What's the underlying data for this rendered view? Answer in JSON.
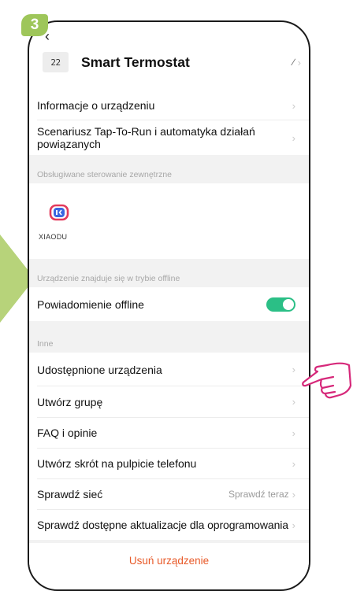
{
  "step": {
    "number": "3"
  },
  "colors": {
    "accent": "#9ec65a",
    "toggle_on": "#2bbf86",
    "danger": "#e85a29",
    "hand": "#d6287a"
  },
  "header": {
    "back_icon": "chevron-left-icon",
    "device_icon_text": "22",
    "title": "Smart Termostat",
    "edit_icon": "pencil-icon"
  },
  "rows": {
    "device_info": "Informacje o urządzeniu",
    "tap_to_run": "Scenariusz Tap-To-Run i automatyka działań powiązanych",
    "offline_notification": "Powiadomienie offline",
    "shared_devices": "Udostępnione urządzenia",
    "create_group": "Utwórz grupę",
    "faq": "FAQ i opinie",
    "shortcut": "Utwórz skrót na pulpicie telefonu",
    "check_network": "Sprawdź sieć",
    "check_network_value": "Sprawdź teraz",
    "check_updates": "Sprawdź dostępne aktualizacje dla oprogramowania"
  },
  "sections": {
    "external_control": "Obsługiwane sterowanie zewnętrzne",
    "offline": "Urządzenie znajduje się w trybie offline",
    "other": "Inne"
  },
  "external": {
    "name": "XIAODU",
    "icon": "xiaodu-icon"
  },
  "toggle": {
    "offline_notification_on": true
  },
  "footer": {
    "remove_device": "Usuń urządzenie"
  }
}
